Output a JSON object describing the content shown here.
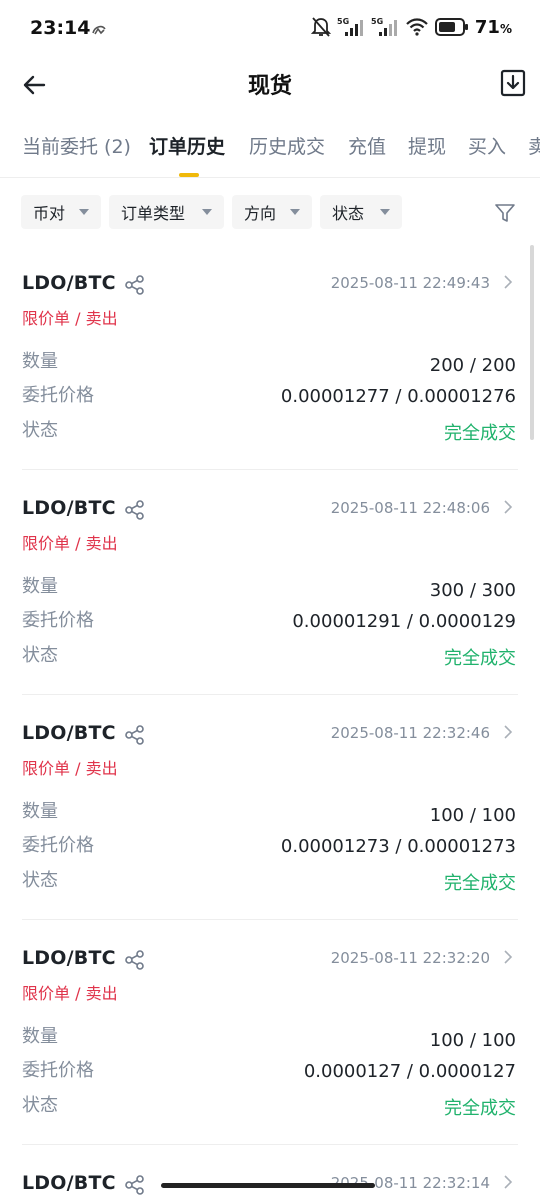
{
  "status_bar": {
    "time": "23:14",
    "battery_percent": "71",
    "battery_unit": "%",
    "network_label_1": "5G",
    "network_label_2": "5G",
    "icons": [
      "app-notification-icon",
      "mute-bell-icon",
      "signal-5g-icon",
      "signal-5g-icon",
      "wifi-icon",
      "battery-icon"
    ]
  },
  "header": {
    "title": "现货",
    "back_icon": "arrow-left-icon",
    "download_icon": "download-icon"
  },
  "tabs": [
    {
      "label": "当前委托 (2)",
      "active": false
    },
    {
      "label": "订单历史",
      "active": true
    },
    {
      "label": "历史成交",
      "active": false
    },
    {
      "label": "充值",
      "active": false
    },
    {
      "label": "提现",
      "active": false
    },
    {
      "label": "买入",
      "active": false
    },
    {
      "label": "卖",
      "active": false
    }
  ],
  "accent_color": "#f0b90b",
  "filters": {
    "chips": [
      {
        "label": "币对"
      },
      {
        "label": "订单类型"
      },
      {
        "label": "方向"
      },
      {
        "label": "状态"
      }
    ],
    "filter_icon": "funnel-icon"
  },
  "field_labels": {
    "quantity": "数量",
    "price": "委托价格",
    "status": "状态"
  },
  "colors": {
    "sell": "#e0344b",
    "filled": "#20b26c"
  },
  "orders": [
    {
      "pair": "LDO/BTC",
      "type": "限价单 / 卖出",
      "time": "2025-08-11 22:49:43",
      "quantity": "200 / 200",
      "price": "0.00001277 / 0.00001276",
      "status": "完全成交"
    },
    {
      "pair": "LDO/BTC",
      "type": "限价单 / 卖出",
      "time": "2025-08-11 22:48:06",
      "quantity": "300 / 300",
      "price": "0.00001291 / 0.0000129",
      "status": "完全成交"
    },
    {
      "pair": "LDO/BTC",
      "type": "限价单 / 卖出",
      "time": "2025-08-11 22:32:46",
      "quantity": "100 / 100",
      "price": "0.00001273 / 0.00001273",
      "status": "完全成交"
    },
    {
      "pair": "LDO/BTC",
      "type": "限价单 / 卖出",
      "time": "2025-08-11 22:32:20",
      "quantity": "100 / 100",
      "price": "0.0000127 / 0.0000127",
      "status": "完全成交"
    },
    {
      "pair": "LDO/BTC",
      "type": "",
      "time": "2025-08-11 22:32:14",
      "quantity": "",
      "price": "",
      "status": ""
    }
  ]
}
